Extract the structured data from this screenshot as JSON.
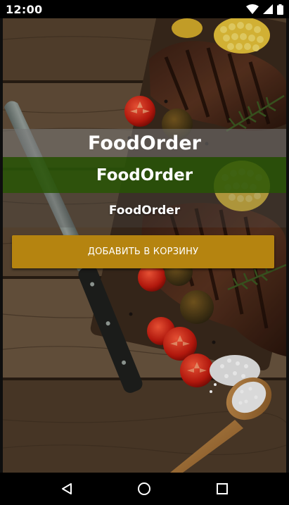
{
  "status_bar": {
    "time": "12:00",
    "icons": [
      "wifi-icon",
      "cellular-signal-icon",
      "battery-icon"
    ]
  },
  "screen": {
    "title_large": "FoodOrder",
    "title_medium": "FoodOrder",
    "title_small": "FoodOrder",
    "add_to_cart_label": "ДОБАВИТЬ В КОРЗИНУ",
    "background_image": "grilled-steak-with-vegetables-photo"
  },
  "colors": {
    "button": "#b58410",
    "green_band": "#295408",
    "status_bar": "#000000",
    "nav_bar": "#000000"
  },
  "nav_bar": {
    "icons": [
      "back-icon",
      "home-icon",
      "recents-icon"
    ]
  }
}
